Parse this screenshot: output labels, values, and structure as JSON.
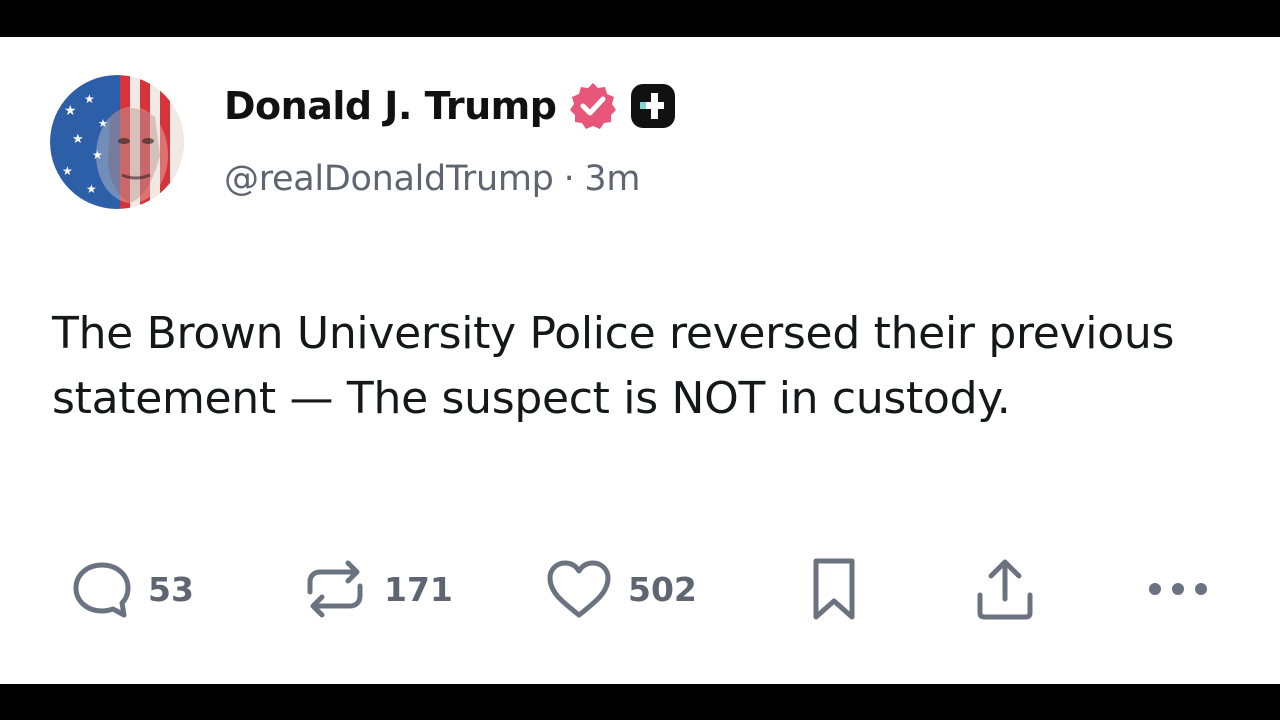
{
  "author": {
    "display_name": "Donald J. Trump",
    "handle": "@realDonaldTrump",
    "separator": "·",
    "timestamp": "3m",
    "avatar_icon": "american-flag-portrait",
    "verified_icon": "verified-badge-icon",
    "verified_color": "#e8567a",
    "plus_badge_icon": "plus-badge-icon"
  },
  "post": {
    "text": "The Brown University Police reversed their previous statement — The suspect is NOT in custody."
  },
  "actions": {
    "replies": "53",
    "reposts": "171",
    "likes": "502"
  },
  "colors": {
    "text_primary": "#111111",
    "text_secondary": "#5f6672",
    "icon": "#6b7280"
  }
}
